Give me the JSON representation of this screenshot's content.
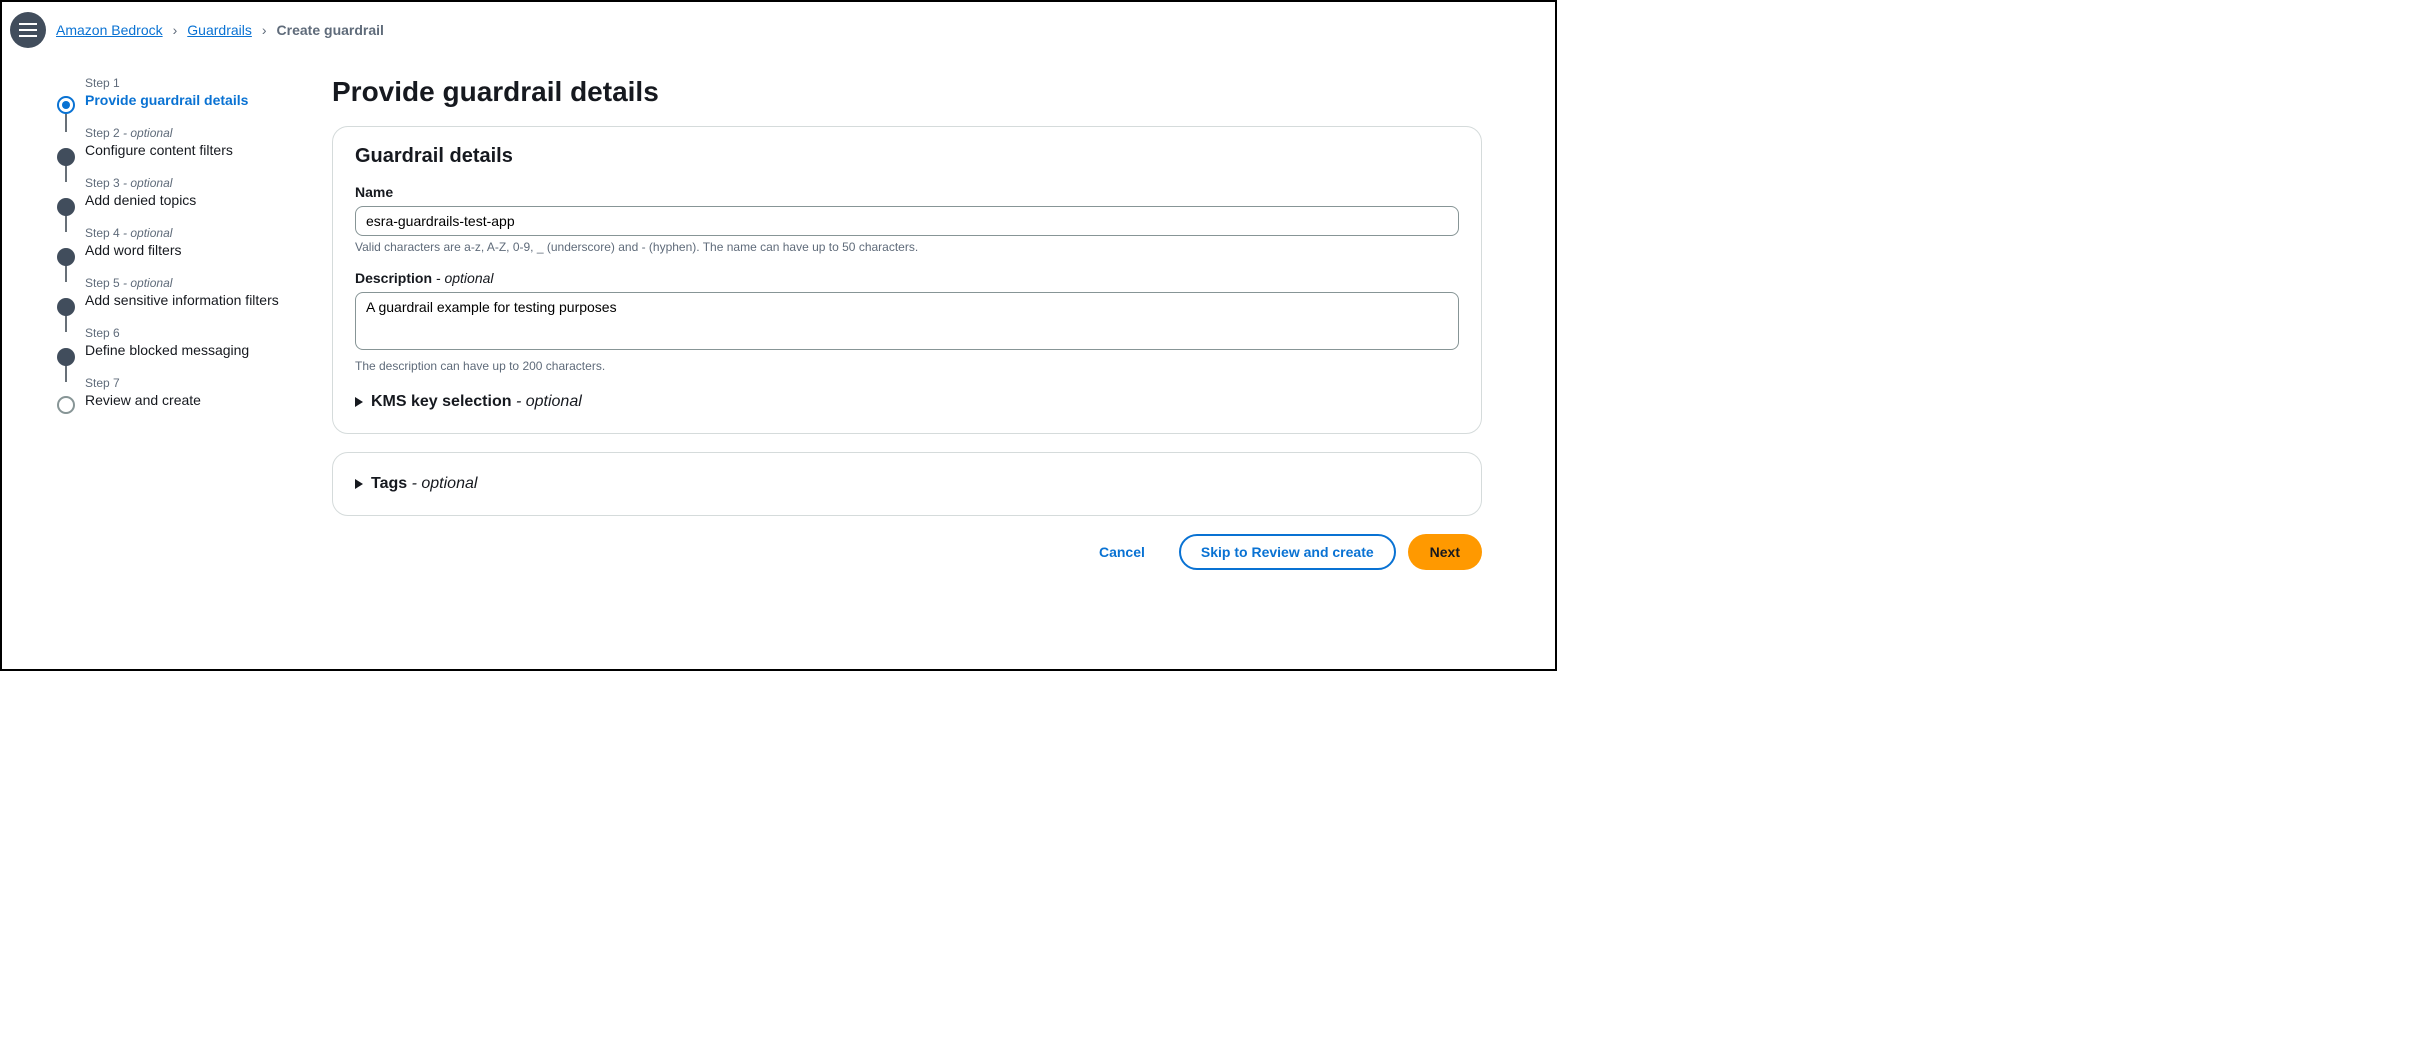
{
  "breadcrumb": {
    "items": [
      "Amazon Bedrock",
      "Guardrails"
    ],
    "current": "Create guardrail"
  },
  "wizard": {
    "steps": [
      {
        "num": "Step 1",
        "optional": false,
        "label": "Provide guardrail details"
      },
      {
        "num": "Step 2",
        "optional": true,
        "label": "Configure content filters"
      },
      {
        "num": "Step 3",
        "optional": true,
        "label": "Add denied topics"
      },
      {
        "num": "Step 4",
        "optional": true,
        "label": "Add word filters"
      },
      {
        "num": "Step 5",
        "optional": true,
        "label": "Add sensitive information filters"
      },
      {
        "num": "Step 6",
        "optional": false,
        "label": "Define blocked messaging"
      },
      {
        "num": "Step 7",
        "optional": false,
        "label": "Review and create"
      }
    ],
    "optional_suffix": " - optional"
  },
  "page_title": "Provide guardrail details",
  "details_panel": {
    "title": "Guardrail details",
    "name_label": "Name",
    "name_value": "esra-guardrails-test-app",
    "name_hint": "Valid characters are a-z, A-Z, 0-9, _ (underscore) and - (hyphen). The name can have up to 50 characters.",
    "desc_label": "Description",
    "desc_optional": " - optional",
    "desc_value": "A guardrail example for testing purposes",
    "desc_hint": "The description can have up to 200 characters.",
    "kms_label": "KMS key selection",
    "kms_optional": " - optional"
  },
  "tags_panel": {
    "label": "Tags",
    "optional": " - optional"
  },
  "actions": {
    "cancel": "Cancel",
    "skip": "Skip to Review and create",
    "next": "Next"
  }
}
